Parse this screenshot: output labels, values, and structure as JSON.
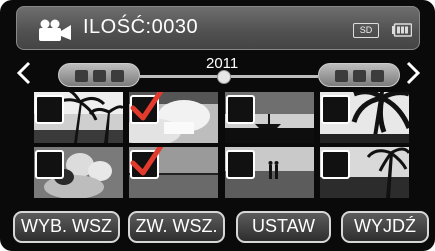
{
  "header": {
    "mode_icon": "video-camera-icon",
    "count_label": "ILOŚĆ:0030",
    "storage_badge": "SD",
    "battery_icon": "battery-icon"
  },
  "navigation": {
    "prev_icon": "chevron-left-icon",
    "next_icon": "chevron-right-icon",
    "year": "2011"
  },
  "thumbnails": [
    {
      "scene": "palm-trees-sunset",
      "selected": false
    },
    {
      "scene": "woman-reading",
      "selected": true
    },
    {
      "scene": "lake-boat-silhouette",
      "selected": false
    },
    {
      "scene": "palm-leaves-silhouette",
      "selected": false
    },
    {
      "scene": "beach-couple",
      "selected": false
    },
    {
      "scene": "sea-horizon",
      "selected": true
    },
    {
      "scene": "couple-on-shore",
      "selected": false
    },
    {
      "scene": "palm-tree-sunset",
      "selected": false
    }
  ],
  "buttons": {
    "select_all": "WYB. WSZ",
    "clear_all": "ZW. WSZ.",
    "set": "USTAW",
    "exit": "WYJDŹ"
  },
  "colors": {
    "checkmark": "#e23b2e",
    "background": "#0a0a0a",
    "button_border": "#d7d7d7"
  }
}
